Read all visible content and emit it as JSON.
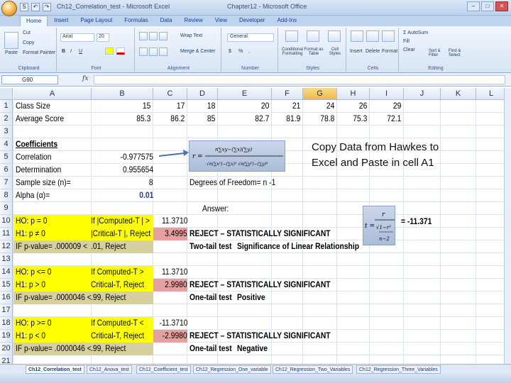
{
  "window": {
    "title_left": "Ch12_Correlation_test - Microsoft Excel",
    "title_right": "Chapter12 - Microsoft Office",
    "qat": [
      "S",
      "↶",
      "↷"
    ],
    "controls": [
      "–",
      "□",
      "✕"
    ]
  },
  "ribbon_tabs": [
    "Home",
    "Insert",
    "Page Layout",
    "Formulas",
    "Data",
    "Review",
    "View",
    "Developer",
    "Add-Ins"
  ],
  "ribbon": {
    "clipboard": {
      "paste": "Paste",
      "cut": "Cut",
      "copy": "Copy",
      "format_painter": "Format Painter",
      "label": "Clipboard"
    },
    "font": {
      "name": "Arial",
      "size": "20",
      "label": "Font",
      "buttons": [
        "B",
        "I",
        "U"
      ]
    },
    "alignment": {
      "wrap": "Wrap Text",
      "merge": "Merge & Center",
      "label": "Alignment"
    },
    "number": {
      "format": "General",
      "symbols": [
        "$",
        "%",
        ","
      ],
      "label": "Number"
    },
    "styles": {
      "items": [
        "Conditional Formatting",
        "Format as Table",
        "Cell Styles"
      ],
      "label": "Styles"
    },
    "cells": {
      "items": [
        "Insert",
        "Delete",
        "Format"
      ],
      "label": "Cells"
    },
    "editing": {
      "autosum": "Σ AutoSum",
      "fill": "Fill",
      "clear": "Clear",
      "sort": "Sort & Filter",
      "find": "Find & Select",
      "label": "Editing"
    }
  },
  "formula_bar": {
    "name_box": "G90",
    "fx": "fx",
    "value": ""
  },
  "columns": [
    "A",
    "B",
    "C",
    "D",
    "E",
    "F",
    "G",
    "H",
    "I",
    "J",
    "K",
    "L"
  ],
  "selected_column": "G",
  "rows": [
    "1",
    "2",
    "3",
    "4",
    "5",
    "6",
    "7",
    "8",
    "9",
    "10",
    "11",
    "12",
    "13",
    "14",
    "15",
    "16",
    "17",
    "18",
    "19",
    "20",
    "21"
  ],
  "cells": {
    "a1": "Class Size",
    "a2": "Average Score",
    "a4": "Coefficients",
    "a5": "Correlation",
    "a6": "Determination",
    "a7": "Sample size (n)=",
    "a8": "Alpha (α)=",
    "a10": "HO: p = 0",
    "a11": "H1: p ≠ 0",
    "a12": "IF p-value= .000009 <",
    "a14": "HO:  p <= 0",
    "a15": "H1:  p > 0",
    "a16": "IF p-value= .0000046 <",
    "a18": "HO:  p >= 0",
    "a19": "H1:  p < 0",
    "a20": "IF p-value= .0000046 <",
    "b10": "If |Computed-T | >",
    "b11": "|Critical-T |, Reject",
    "b12": ".01, Reject",
    "b14": "If Computed-T >",
    "b15": "Critical-T, Reject",
    "b16": ".99, Reject",
    "b18": "If Computed-T <",
    "b19": "Critical-T, Reject",
    "b20": ".99, Reject",
    "b5": "-0.977575",
    "b6": "0.955654",
    "b7": "8",
    "b8": "0.01",
    "c10": "11.3710",
    "c11": "3.4995",
    "c14": "11.3710",
    "c15": "2.9980",
    "c18": "-11.3710",
    "c19": "-2.9980",
    "d11": "REJECT – STATISTICALLY SIGNIFICANT",
    "d12a": "Two-tail test",
    "d12b": "Significance of Linear Relationship",
    "d15": "REJECT – STATISTICALLY SIGNIFICANT",
    "d16a": "One-tail test",
    "d16b": "Positive",
    "d19": "REJECT – STATISTICALLY SIGNIFICANT",
    "d20a": "One-tail test",
    "d20b": "Negative",
    "d8": "Degrees of Freedom= n -1",
    "d9": "Answer:",
    "result": "= -11.371"
  },
  "row1_values": [
    "15",
    "17",
    "18",
    "20",
    "21",
    "24",
    "26",
    "29"
  ],
  "row2_values": [
    "85.3",
    "86.2",
    "85",
    "82.7",
    "81.9",
    "78.8",
    "75.3",
    "72.1"
  ],
  "note": [
    "Copy Data from Hawkes to",
    "Excel and Paste in cell A1"
  ],
  "sheet_tabs": [
    "Ch12_Correlation_test",
    "Ch12_Anova_test",
    "Ch12_Coefficient_test",
    "Ch12_Regression_One_variable",
    "Ch12_Regression_Two_Variables",
    "Ch12_Regression_Three_Variables"
  ],
  "colors": {
    "yellow": "#ffff00",
    "khaki": "#d6d0a0",
    "pink": "#e7a0a0",
    "selected": "#f4c35a"
  }
}
